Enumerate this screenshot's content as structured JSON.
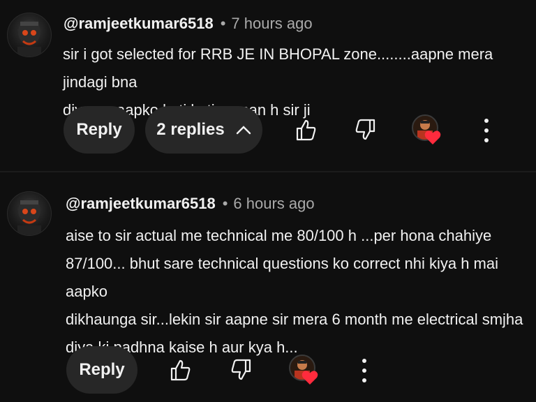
{
  "comments": [
    {
      "handle": "@ramjeetkumar6518",
      "separator": "•",
      "time": "7 hours ago",
      "lines": [
        "sir i got selected for RRB JE IN BHOPAL zone........aapne mera jindagi bna",
        "diya......aapko koti koti naman h sir ji"
      ],
      "reply_label": "Reply",
      "replies_label": "2 replies",
      "icons": {
        "avatar": "user-avatar",
        "like": "thumbs-up-icon",
        "dislike": "thumbs-down-icon",
        "creator_heart": "creator-heart-icon",
        "more": "more-vert-icon"
      }
    },
    {
      "handle": "@ramjeetkumar6518",
      "separator": "•",
      "time": "6 hours ago",
      "lines": [
        "aise to sir actual me technical me 80/100 h ...per hona chahiye",
        "87/100... bhut sare technical questions ko correct nhi kiya h mai aapko",
        "dikhaunga sir...lekin sir aapne sir mera 6 month me electrical smjha",
        "diya ki padhna kaise h aur kya h..."
      ],
      "reply_label": "Reply",
      "icons": {
        "avatar": "user-avatar",
        "like": "thumbs-up-icon",
        "dislike": "thumbs-down-icon",
        "creator_heart": "creator-heart-icon",
        "more": "more-vert-icon"
      }
    }
  ],
  "colors": {
    "background": "#0f0f0f",
    "text": "#f1f1f1",
    "secondary_text": "#aaaaaa",
    "button_bg": "#272727",
    "heart": "#ff2b3d"
  }
}
